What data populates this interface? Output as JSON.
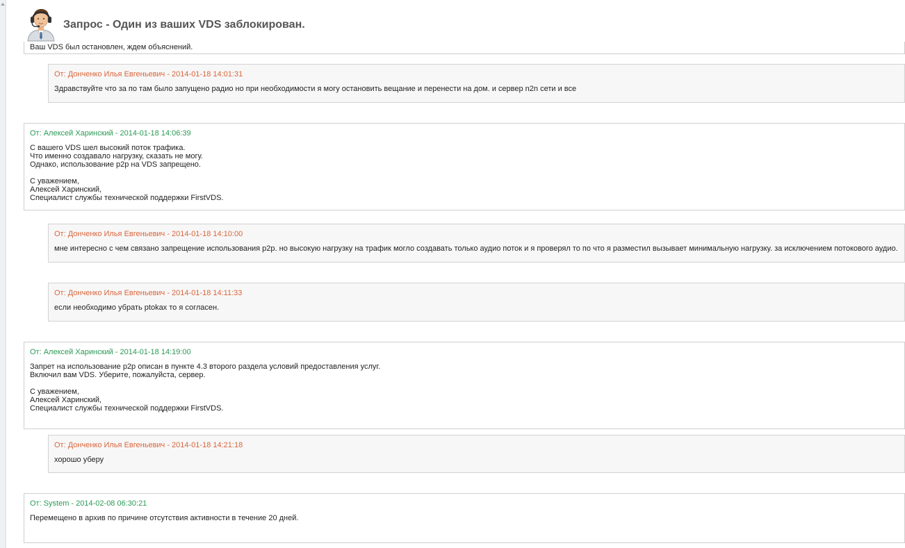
{
  "header": {
    "title": "Запрос - Один из ваших VDS заблокирован.",
    "avatar": "support-operator-icon"
  },
  "thread": {
    "cut_message_text": "Ваш VDS был остановлен, ждем объяснений.",
    "messages": [
      {
        "role": "client",
        "head": "От: Донченко Илья Евгеньевич - 2014-01-18 14:01:31",
        "body": "Здравствуйте что за по там было запущено радио но при необходимости я могу остановить вещание и перенести на дом. и сервер n2n сети и все"
      },
      {
        "role": "support",
        "head": "От: Алексей Харинский - 2014-01-18 14:06:39",
        "body": "С вашего VDS шел высокий поток трафика.\nЧто именно создавало нагрузку, сказать не могу.\nОднако, использование p2p на VDS запрещено.\n\nС уважением,\nАлексей Харинский,\nСпециалист службы технической поддержки FirstVDS."
      },
      {
        "role": "client",
        "head": "От: Донченко Илья Евгеньевич - 2014-01-18 14:10:00",
        "body": "мне интересно с чем связано запрещение использования p2p. но высокую нагрузку на трафик могло создавать только аудио поток и я проверял то по что я разместил вызывает минимальную нагрузку. за исключением потокового аудио."
      },
      {
        "role": "client",
        "head": "От: Донченко Илья Евгеньевич - 2014-01-18 14:11:33",
        "body": "если необходимо убрать ptokax то я согласен."
      },
      {
        "role": "support",
        "head": "От: Алексей Харинский - 2014-01-18 14:19:00",
        "body": "Запрет на использование p2p описан в пункте 4.3 второго раздела условий предоставления услуг.\nВключил вам VDS. Уберите, пожалуйста, сервер.\n\nС уважением,\nАлексей Харинский,\nСпециалист службы технической поддержки FirstVDS."
      },
      {
        "role": "client",
        "head": "От: Донченко Илья Евгеньевич - 2014-01-18 14:21:18",
        "body": "хорошо уберу"
      },
      {
        "role": "support",
        "head": "От: System - 2014-02-08 06:30:21",
        "body": "Перемещено в архив по причине отсутствия активности в течение 20 дней."
      }
    ]
  }
}
